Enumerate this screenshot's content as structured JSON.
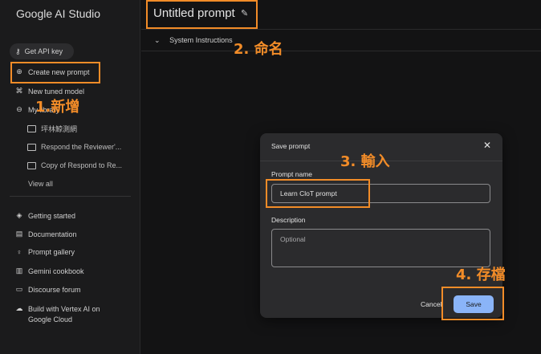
{
  "app": {
    "brand": "Google AI Studio"
  },
  "sidebar": {
    "api_key": {
      "label": "Get API key",
      "icon": "key-icon"
    },
    "items": [
      {
        "label": "Create new prompt",
        "icon": "add-circle-icon"
      },
      {
        "label": "New tuned model",
        "icon": "tune-icon"
      },
      {
        "label": "My library",
        "icon": "library-icon"
      }
    ],
    "library_items": [
      {
        "label": "坪林鯨測網"
      },
      {
        "label": "Respond the Reviewer'..."
      },
      {
        "label": "Copy of Respond to Re..."
      }
    ],
    "view_all": "View all",
    "footer_items": [
      {
        "label": "Getting started",
        "icon": "compass-icon"
      },
      {
        "label": "Documentation",
        "icon": "document-icon"
      },
      {
        "label": "Prompt gallery",
        "icon": "lightbulb-icon"
      },
      {
        "label": "Gemini cookbook",
        "icon": "book-icon"
      },
      {
        "label": "Discourse forum",
        "icon": "forum-icon"
      },
      {
        "label": "Build with Vertex AI on",
        "label2": "Google Cloud",
        "icon": "cloud-icon"
      }
    ]
  },
  "header": {
    "title": "Untitled prompt"
  },
  "system_instructions": {
    "label": "System Instructions"
  },
  "dialog": {
    "title": "Save prompt",
    "name_label": "Prompt name",
    "name_value": "Learn CloT prompt",
    "description_label": "Description",
    "description_placeholder": "Optional",
    "cancel_label": "Cancel",
    "save_label": "Save"
  },
  "annotations": {
    "step1": "1.新增",
    "step2": "2. 命名",
    "step3": "3. 輸入",
    "step4": "4. 存檔",
    "color": "#f28c28"
  }
}
